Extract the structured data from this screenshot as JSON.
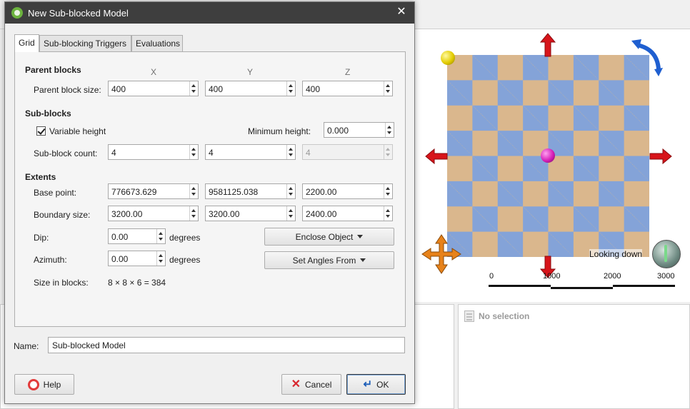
{
  "dialog": {
    "title": "New Sub-blocked Model",
    "close_glyph": "✕",
    "tabs": [
      "Grid",
      "Sub-blocking Triggers",
      "Evaluations"
    ],
    "active_tab": "Grid",
    "axes": {
      "x": "X",
      "y": "Y",
      "z": "Z"
    },
    "parent_blocks": {
      "heading": "Parent blocks",
      "size_label": "Parent block size:",
      "size_x": "400",
      "size_y": "400",
      "size_z": "400"
    },
    "sub_blocks": {
      "heading": "Sub-blocks",
      "variable_height_label": "Variable height",
      "variable_height_checked": true,
      "minimum_height_label": "Minimum height:",
      "minimum_height": "0.000",
      "count_label": "Sub-block count:",
      "count_x": "4",
      "count_y": "4",
      "count_z": "4"
    },
    "extents": {
      "heading": "Extents",
      "base_point_label": "Base point:",
      "base_x": "776673.629",
      "base_y": "9581125.038",
      "base_z": "2200.00",
      "boundary_size_label": "Boundary size:",
      "boundary_x": "3200.00",
      "boundary_y": "3200.00",
      "boundary_z": "2400.00",
      "dip_label": "Dip:",
      "dip": "0.00",
      "azimuth_label": "Azimuth:",
      "azimuth": "0.00",
      "degrees_unit": "degrees",
      "enclose_object_button": "Enclose Object",
      "set_angles_from_button": "Set Angles From",
      "size_in_blocks_label": "Size in blocks:",
      "size_in_blocks_value": "8 × 8 × 6 = 384"
    },
    "name_label": "Name:",
    "name_value": "Sub-blocked Model",
    "help_button": "Help",
    "cancel_button": "Cancel",
    "ok_button": "OK"
  },
  "viewport": {
    "view_label": "Looking down",
    "scale_labels": [
      "0",
      "1000",
      "2000",
      "3000"
    ],
    "arrow_color": "#d7141a",
    "handle_color": "#e7821a",
    "rotate_color": "#1f5fd0"
  },
  "properties_panel": {
    "empty_text": "No selection"
  }
}
